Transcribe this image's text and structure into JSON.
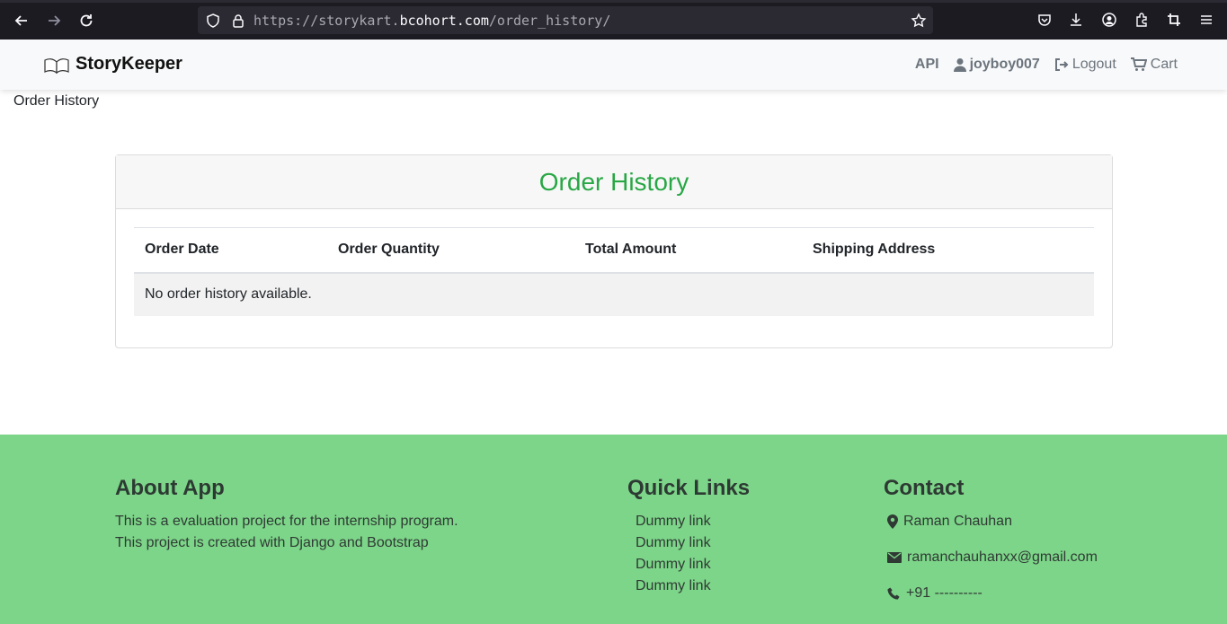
{
  "browser": {
    "url_prefix": "https://storykart.",
    "url_domain": "bcohort.com",
    "url_path": "/order_history/"
  },
  "navbar": {
    "brand": "StoryKeeper",
    "api_label": "API",
    "user_label": "joyboy007",
    "logout_label": "Logout",
    "cart_label": "Cart"
  },
  "breadcrumb": "Order History",
  "card": {
    "title": "Order History",
    "columns": [
      "Order Date",
      "Order Quantity",
      "Total Amount",
      "Shipping Address"
    ],
    "empty_message": "No order history available."
  },
  "footer": {
    "about": {
      "heading": "About App",
      "line1": "This is a evaluation project for the internship program.",
      "line2": "This project is created with Django and Bootstrap"
    },
    "quick_links": {
      "heading": "Quick Links",
      "links": [
        "Dummy link",
        "Dummy link",
        "Dummy link",
        "Dummy link"
      ]
    },
    "contact": {
      "heading": "Contact",
      "name": "Raman Chauhan",
      "email": "ramanchauhanxx@gmail.com",
      "phone": "+91 ----------"
    }
  },
  "colors": {
    "accent_green": "#28a745",
    "footer_bg": "#7dd589"
  }
}
